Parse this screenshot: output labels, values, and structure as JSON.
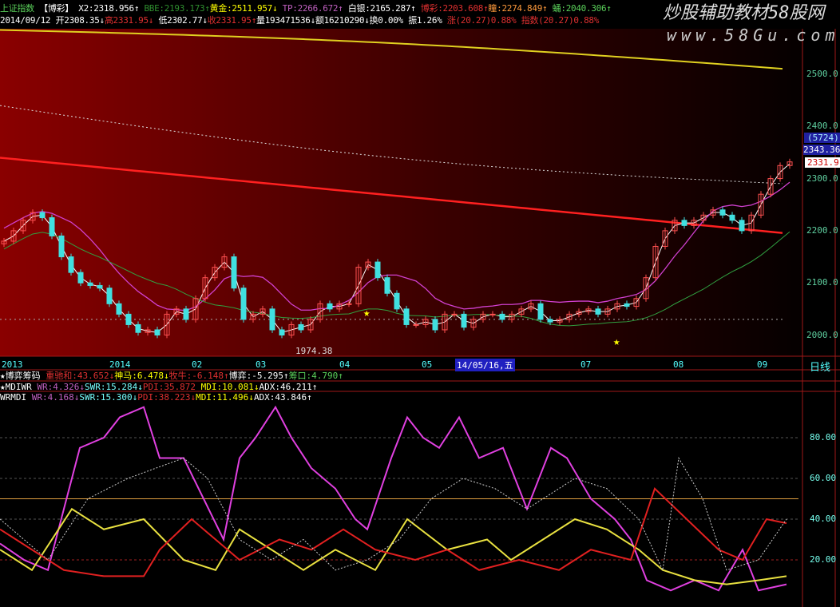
{
  "header": {
    "line1": [
      {
        "t": "上证指数",
        "c": "gr"
      },
      {
        "t": " 【博彩】 ",
        "c": "w"
      },
      {
        "t": "X2:2318.956↑",
        "c": "w"
      },
      {
        "t": " BBE:2193.173↑",
        "c": "g"
      },
      {
        "t": "黄金:2511.957↓",
        "c": "y"
      },
      {
        "t": " TP:2266.672↑",
        "c": "m"
      },
      {
        "t": " 白银:2165.287↑",
        "c": "w"
      },
      {
        "t": " 博彩:2203.608↑",
        "c": "r"
      },
      {
        "t": "瞳:2274.849↑",
        "c": "o"
      },
      {
        "t": " 蛹:2040.306↑",
        "c": "gr"
      }
    ],
    "line2": [
      {
        "t": "2014/09/12 ",
        "c": "w"
      },
      {
        "t": "开2308.35↓",
        "c": "w"
      },
      {
        "t": "高2331.95↓",
        "c": "r"
      },
      {
        "t": " 低2302.77↓",
        "c": "w"
      },
      {
        "t": "收2331.95↑",
        "c": "r"
      },
      {
        "t": "量193471536↓",
        "c": "w"
      },
      {
        "t": "额16210290↓",
        "c": "w"
      },
      {
        "t": "换0.00%",
        "c": "w"
      },
      {
        "t": " 振1.26%",
        "c": "w"
      },
      {
        "t": " 涨(20.27)0.88%",
        "c": "r"
      },
      {
        "t": " 指数(20.27)0.88%",
        "c": "r"
      }
    ]
  },
  "watermark": {
    "title": "炒股辅助教材58股网",
    "url": "www.58Gu.com"
  },
  "price_axis": {
    "ticks": [
      "2500.0",
      "2400.0",
      "2300.0",
      "2200.0",
      "2100.0",
      "2000.0"
    ],
    "volume_tag": "(5724)",
    "cursor_price": "2343.36",
    "last_price": "2331.9",
    "low_mark": "1974.38"
  },
  "x_axis": {
    "labels": [
      "2013",
      "2014",
      "02",
      "03",
      "04",
      "05",
      "07",
      "08",
      "09"
    ],
    "cursor_date": "14/05/16,五",
    "period": "日线"
  },
  "indicators": {
    "line1": [
      {
        "t": "★博弈筹码 ",
        "c": "w"
      },
      {
        "t": "重驰和:43.652↓",
        "c": "r"
      },
      {
        "t": "神马:6.478↓",
        "c": "y"
      },
      {
        "t": "牧牛:-6.148↑",
        "c": "r"
      },
      {
        "t": "博弈:-5.295↑",
        "c": "w"
      },
      {
        "t": "筹口:4.790↑",
        "c": "gr"
      }
    ],
    "line2": [
      {
        "t": "★MDIWR ",
        "c": "w"
      },
      {
        "t": "WR:4.326↓",
        "c": "m"
      },
      {
        "t": "SWR:15.284↓",
        "c": "cy"
      },
      {
        "t": "PDI:35.872",
        "c": "r"
      },
      {
        "t": " MDI:10.081↓",
        "c": "y"
      },
      {
        "t": "ADX:46.211↑",
        "c": "w"
      }
    ],
    "line3": [
      {
        "t": "WRMDI ",
        "c": "w"
      },
      {
        "t": "WR:4.168↓",
        "c": "m"
      },
      {
        "t": "SWR:15.300↓",
        "c": "cy"
      },
      {
        "t": "PDI:38.223↓",
        "c": "r"
      },
      {
        "t": "MDI:11.496↓",
        "c": "y"
      },
      {
        "t": "ADX:43.846↑",
        "c": "w"
      }
    ],
    "ticks": [
      "80.00",
      "60.00",
      "40.00",
      "20.00"
    ]
  },
  "chart_data": [
    {
      "type": "candlestick",
      "title": "上证指数 日线",
      "ylim": [
        1960,
        2580
      ],
      "close": [
        2180,
        2200,
        2220,
        2235,
        2225,
        2190,
        2150,
        2120,
        2100,
        2095,
        2090,
        2060,
        2040,
        2020,
        2005,
        2010,
        2000,
        2040,
        2050,
        2030,
        2070,
        2110,
        2130,
        2150,
        2090,
        2030,
        2040,
        2050,
        2010,
        2000,
        2020,
        2010,
        2030,
        2060,
        2050,
        2060,
        2060,
        2130,
        2140,
        2110,
        2080,
        2050,
        2020,
        2020,
        2030,
        2010,
        2040,
        2040,
        2015,
        2030,
        2040,
        2040,
        2030,
        2040,
        2050,
        2060,
        2030,
        2025,
        2030,
        2040,
        2045,
        2050,
        2040,
        2050,
        2060,
        2055,
        2070,
        2110,
        2170,
        2200,
        2220,
        2210,
        2220,
        2230,
        2240,
        2230,
        2220,
        2200,
        2230,
        2270,
        2300,
        2325,
        2332
      ],
      "ma_long_red": [
        2340,
        2195
      ],
      "ma_yellow": [
        2585,
        2510
      ],
      "series_ma": [
        "MA5 white",
        "MA20 magenta",
        "MA60 green"
      ]
    },
    {
      "type": "line",
      "title": "WRMDI",
      "ylim": [
        0,
        100
      ],
      "ref_lines": [
        80,
        60,
        50,
        40,
        20
      ],
      "series": [
        {
          "name": "WR",
          "color": "#e040e0",
          "x": [
            0,
            30,
            60,
            80,
            100,
            130,
            150,
            180,
            200,
            230,
            255,
            280,
            300,
            320,
            345,
            365,
            390,
            420,
            445,
            460,
            490,
            510,
            530,
            550,
            575,
            600,
            630,
            660,
            690,
            710,
            740,
            770,
            790,
            810,
            840,
            870,
            900,
            930,
            950,
            985
          ],
          "y": [
            28,
            20,
            15,
            45,
            75,
            80,
            90,
            95,
            70,
            70,
            50,
            30,
            70,
            80,
            95,
            80,
            65,
            55,
            40,
            35,
            70,
            90,
            80,
            75,
            90,
            70,
            75,
            45,
            75,
            70,
            50,
            40,
            30,
            10,
            5,
            10,
            5,
            25,
            5,
            8
          ]
        },
        {
          "name": "MDI",
          "color": "#e8e040",
          "x": [
            0,
            40,
            90,
            130,
            180,
            230,
            270,
            300,
            340,
            380,
            420,
            470,
            510,
            560,
            610,
            640,
            680,
            720,
            760,
            800,
            830,
            870,
            910,
            950,
            985
          ],
          "y": [
            25,
            15,
            45,
            35,
            40,
            20,
            15,
            35,
            25,
            15,
            25,
            15,
            40,
            25,
            30,
            20,
            30,
            40,
            35,
            25,
            15,
            10,
            8,
            10,
            12
          ]
        },
        {
          "name": "PDI",
          "color": "#e02020",
          "x": [
            0,
            40,
            80,
            130,
            180,
            200,
            240,
            270,
            300,
            350,
            390,
            430,
            470,
            520,
            560,
            600,
            650,
            700,
            740,
            790,
            820,
            860,
            900,
            930,
            960,
            985
          ],
          "y": [
            35,
            25,
            15,
            12,
            12,
            25,
            40,
            30,
            20,
            30,
            25,
            35,
            25,
            20,
            25,
            15,
            20,
            15,
            25,
            20,
            55,
            40,
            25,
            20,
            40,
            38
          ]
        },
        {
          "name": "ADX",
          "color": "#cccccc",
          "x": [
            0,
            60,
            110,
            160,
            230,
            260,
            300,
            340,
            380,
            420,
            460,
            500,
            540,
            580,
            620,
            660,
            720,
            760,
            800,
            830,
            850,
            880,
            910,
            950,
            985
          ],
          "y": [
            40,
            20,
            50,
            60,
            70,
            60,
            30,
            20,
            30,
            15,
            20,
            30,
            50,
            60,
            55,
            45,
            60,
            55,
            40,
            15,
            70,
            50,
            15,
            20,
            40
          ]
        }
      ]
    }
  ]
}
